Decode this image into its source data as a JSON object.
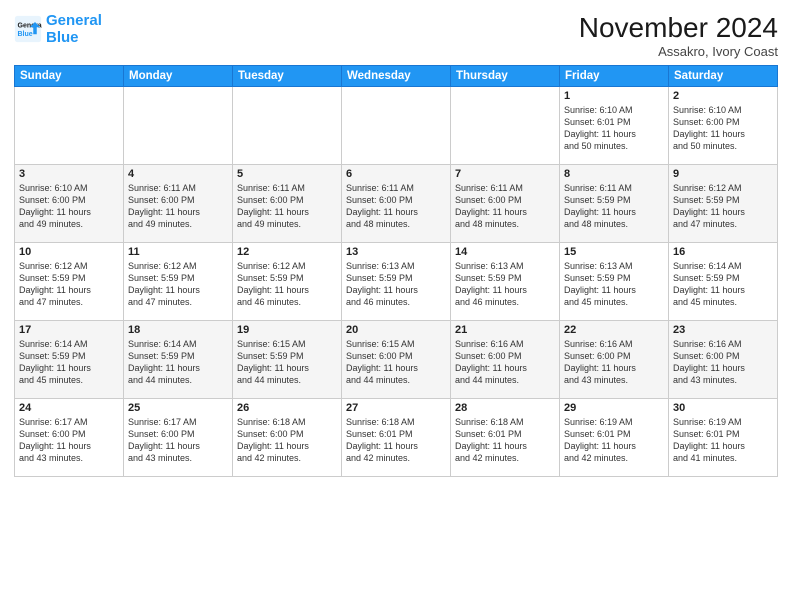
{
  "logo": {
    "line1": "General",
    "line2": "Blue"
  },
  "title": "November 2024",
  "location": "Assakro, Ivory Coast",
  "header_days": [
    "Sunday",
    "Monday",
    "Tuesday",
    "Wednesday",
    "Thursday",
    "Friday",
    "Saturday"
  ],
  "weeks": [
    [
      {
        "day": "",
        "info": ""
      },
      {
        "day": "",
        "info": ""
      },
      {
        "day": "",
        "info": ""
      },
      {
        "day": "",
        "info": ""
      },
      {
        "day": "",
        "info": ""
      },
      {
        "day": "1",
        "info": "Sunrise: 6:10 AM\nSunset: 6:01 PM\nDaylight: 11 hours\nand 50 minutes."
      },
      {
        "day": "2",
        "info": "Sunrise: 6:10 AM\nSunset: 6:00 PM\nDaylight: 11 hours\nand 50 minutes."
      }
    ],
    [
      {
        "day": "3",
        "info": "Sunrise: 6:10 AM\nSunset: 6:00 PM\nDaylight: 11 hours\nand 49 minutes."
      },
      {
        "day": "4",
        "info": "Sunrise: 6:11 AM\nSunset: 6:00 PM\nDaylight: 11 hours\nand 49 minutes."
      },
      {
        "day": "5",
        "info": "Sunrise: 6:11 AM\nSunset: 6:00 PM\nDaylight: 11 hours\nand 49 minutes."
      },
      {
        "day": "6",
        "info": "Sunrise: 6:11 AM\nSunset: 6:00 PM\nDaylight: 11 hours\nand 48 minutes."
      },
      {
        "day": "7",
        "info": "Sunrise: 6:11 AM\nSunset: 6:00 PM\nDaylight: 11 hours\nand 48 minutes."
      },
      {
        "day": "8",
        "info": "Sunrise: 6:11 AM\nSunset: 5:59 PM\nDaylight: 11 hours\nand 48 minutes."
      },
      {
        "day": "9",
        "info": "Sunrise: 6:12 AM\nSunset: 5:59 PM\nDaylight: 11 hours\nand 47 minutes."
      }
    ],
    [
      {
        "day": "10",
        "info": "Sunrise: 6:12 AM\nSunset: 5:59 PM\nDaylight: 11 hours\nand 47 minutes."
      },
      {
        "day": "11",
        "info": "Sunrise: 6:12 AM\nSunset: 5:59 PM\nDaylight: 11 hours\nand 47 minutes."
      },
      {
        "day": "12",
        "info": "Sunrise: 6:12 AM\nSunset: 5:59 PM\nDaylight: 11 hours\nand 46 minutes."
      },
      {
        "day": "13",
        "info": "Sunrise: 6:13 AM\nSunset: 5:59 PM\nDaylight: 11 hours\nand 46 minutes."
      },
      {
        "day": "14",
        "info": "Sunrise: 6:13 AM\nSunset: 5:59 PM\nDaylight: 11 hours\nand 46 minutes."
      },
      {
        "day": "15",
        "info": "Sunrise: 6:13 AM\nSunset: 5:59 PM\nDaylight: 11 hours\nand 45 minutes."
      },
      {
        "day": "16",
        "info": "Sunrise: 6:14 AM\nSunset: 5:59 PM\nDaylight: 11 hours\nand 45 minutes."
      }
    ],
    [
      {
        "day": "17",
        "info": "Sunrise: 6:14 AM\nSunset: 5:59 PM\nDaylight: 11 hours\nand 45 minutes."
      },
      {
        "day": "18",
        "info": "Sunrise: 6:14 AM\nSunset: 5:59 PM\nDaylight: 11 hours\nand 44 minutes."
      },
      {
        "day": "19",
        "info": "Sunrise: 6:15 AM\nSunset: 5:59 PM\nDaylight: 11 hours\nand 44 minutes."
      },
      {
        "day": "20",
        "info": "Sunrise: 6:15 AM\nSunset: 6:00 PM\nDaylight: 11 hours\nand 44 minutes."
      },
      {
        "day": "21",
        "info": "Sunrise: 6:16 AM\nSunset: 6:00 PM\nDaylight: 11 hours\nand 44 minutes."
      },
      {
        "day": "22",
        "info": "Sunrise: 6:16 AM\nSunset: 6:00 PM\nDaylight: 11 hours\nand 43 minutes."
      },
      {
        "day": "23",
        "info": "Sunrise: 6:16 AM\nSunset: 6:00 PM\nDaylight: 11 hours\nand 43 minutes."
      }
    ],
    [
      {
        "day": "24",
        "info": "Sunrise: 6:17 AM\nSunset: 6:00 PM\nDaylight: 11 hours\nand 43 minutes."
      },
      {
        "day": "25",
        "info": "Sunrise: 6:17 AM\nSunset: 6:00 PM\nDaylight: 11 hours\nand 43 minutes."
      },
      {
        "day": "26",
        "info": "Sunrise: 6:18 AM\nSunset: 6:00 PM\nDaylight: 11 hours\nand 42 minutes."
      },
      {
        "day": "27",
        "info": "Sunrise: 6:18 AM\nSunset: 6:01 PM\nDaylight: 11 hours\nand 42 minutes."
      },
      {
        "day": "28",
        "info": "Sunrise: 6:18 AM\nSunset: 6:01 PM\nDaylight: 11 hours\nand 42 minutes."
      },
      {
        "day": "29",
        "info": "Sunrise: 6:19 AM\nSunset: 6:01 PM\nDaylight: 11 hours\nand 42 minutes."
      },
      {
        "day": "30",
        "info": "Sunrise: 6:19 AM\nSunset: 6:01 PM\nDaylight: 11 hours\nand 41 minutes."
      }
    ]
  ]
}
